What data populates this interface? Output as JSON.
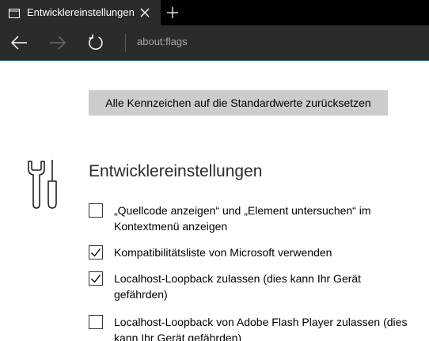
{
  "tab": {
    "title": "Entwicklereinstellungen",
    "page_icon": "page-icon",
    "close_icon": "close-icon",
    "new_tab_icon": "plus-icon"
  },
  "navbar": {
    "back_icon": "arrow-left-icon",
    "forward_icon": "arrow-right-icon",
    "refresh_icon": "refresh-icon",
    "address": "about:flags"
  },
  "content": {
    "reset_button_label": "Alle Kennzeichen auf die Standardwerte zurücksetzen",
    "section_icon": "tools-icon",
    "section_title": "Entwicklereinstellungen",
    "options": [
      {
        "label": "„Quellcode anzeigen“ und „Element untersuchen“ im Kontextmenü anzeigen",
        "checked": false
      },
      {
        "label": "Kompatibilitätsliste von Microsoft verwenden",
        "checked": true
      },
      {
        "label": "Localhost-Loopback zulassen (dies kann Ihr Gerät gefährden)",
        "checked": true
      },
      {
        "label": "Localhost-Loopback von Adobe Flash Player zulassen (dies kann Ihr Gerät gefährden)",
        "checked": false
      }
    ]
  },
  "colors": {
    "titlebar": "#000000",
    "tab_active": "#2b2b2b",
    "navbar": "#2b2b2b",
    "accent": "#0a76c7",
    "button_bg": "#cccccc"
  }
}
